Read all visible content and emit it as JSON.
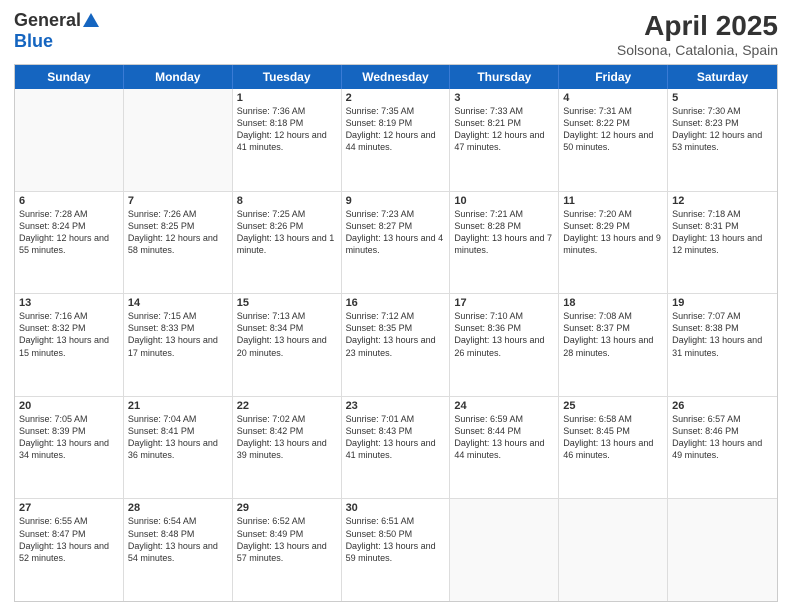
{
  "header": {
    "logo_general": "General",
    "logo_blue": "Blue",
    "title": "April 2025",
    "subtitle": "Solsona, Catalonia, Spain"
  },
  "days": [
    "Sunday",
    "Monday",
    "Tuesday",
    "Wednesday",
    "Thursday",
    "Friday",
    "Saturday"
  ],
  "weeks": [
    [
      {
        "day": "",
        "sunrise": "",
        "sunset": "",
        "daylight": ""
      },
      {
        "day": "",
        "sunrise": "",
        "sunset": "",
        "daylight": ""
      },
      {
        "day": "1",
        "sunrise": "Sunrise: 7:36 AM",
        "sunset": "Sunset: 8:18 PM",
        "daylight": "Daylight: 12 hours and 41 minutes."
      },
      {
        "day": "2",
        "sunrise": "Sunrise: 7:35 AM",
        "sunset": "Sunset: 8:19 PM",
        "daylight": "Daylight: 12 hours and 44 minutes."
      },
      {
        "day": "3",
        "sunrise": "Sunrise: 7:33 AM",
        "sunset": "Sunset: 8:21 PM",
        "daylight": "Daylight: 12 hours and 47 minutes."
      },
      {
        "day": "4",
        "sunrise": "Sunrise: 7:31 AM",
        "sunset": "Sunset: 8:22 PM",
        "daylight": "Daylight: 12 hours and 50 minutes."
      },
      {
        "day": "5",
        "sunrise": "Sunrise: 7:30 AM",
        "sunset": "Sunset: 8:23 PM",
        "daylight": "Daylight: 12 hours and 53 minutes."
      }
    ],
    [
      {
        "day": "6",
        "sunrise": "Sunrise: 7:28 AM",
        "sunset": "Sunset: 8:24 PM",
        "daylight": "Daylight: 12 hours and 55 minutes."
      },
      {
        "day": "7",
        "sunrise": "Sunrise: 7:26 AM",
        "sunset": "Sunset: 8:25 PM",
        "daylight": "Daylight: 12 hours and 58 minutes."
      },
      {
        "day": "8",
        "sunrise": "Sunrise: 7:25 AM",
        "sunset": "Sunset: 8:26 PM",
        "daylight": "Daylight: 13 hours and 1 minute."
      },
      {
        "day": "9",
        "sunrise": "Sunrise: 7:23 AM",
        "sunset": "Sunset: 8:27 PM",
        "daylight": "Daylight: 13 hours and 4 minutes."
      },
      {
        "day": "10",
        "sunrise": "Sunrise: 7:21 AM",
        "sunset": "Sunset: 8:28 PM",
        "daylight": "Daylight: 13 hours and 7 minutes."
      },
      {
        "day": "11",
        "sunrise": "Sunrise: 7:20 AM",
        "sunset": "Sunset: 8:29 PM",
        "daylight": "Daylight: 13 hours and 9 minutes."
      },
      {
        "day": "12",
        "sunrise": "Sunrise: 7:18 AM",
        "sunset": "Sunset: 8:31 PM",
        "daylight": "Daylight: 13 hours and 12 minutes."
      }
    ],
    [
      {
        "day": "13",
        "sunrise": "Sunrise: 7:16 AM",
        "sunset": "Sunset: 8:32 PM",
        "daylight": "Daylight: 13 hours and 15 minutes."
      },
      {
        "day": "14",
        "sunrise": "Sunrise: 7:15 AM",
        "sunset": "Sunset: 8:33 PM",
        "daylight": "Daylight: 13 hours and 17 minutes."
      },
      {
        "day": "15",
        "sunrise": "Sunrise: 7:13 AM",
        "sunset": "Sunset: 8:34 PM",
        "daylight": "Daylight: 13 hours and 20 minutes."
      },
      {
        "day": "16",
        "sunrise": "Sunrise: 7:12 AM",
        "sunset": "Sunset: 8:35 PM",
        "daylight": "Daylight: 13 hours and 23 minutes."
      },
      {
        "day": "17",
        "sunrise": "Sunrise: 7:10 AM",
        "sunset": "Sunset: 8:36 PM",
        "daylight": "Daylight: 13 hours and 26 minutes."
      },
      {
        "day": "18",
        "sunrise": "Sunrise: 7:08 AM",
        "sunset": "Sunset: 8:37 PM",
        "daylight": "Daylight: 13 hours and 28 minutes."
      },
      {
        "day": "19",
        "sunrise": "Sunrise: 7:07 AM",
        "sunset": "Sunset: 8:38 PM",
        "daylight": "Daylight: 13 hours and 31 minutes."
      }
    ],
    [
      {
        "day": "20",
        "sunrise": "Sunrise: 7:05 AM",
        "sunset": "Sunset: 8:39 PM",
        "daylight": "Daylight: 13 hours and 34 minutes."
      },
      {
        "day": "21",
        "sunrise": "Sunrise: 7:04 AM",
        "sunset": "Sunset: 8:41 PM",
        "daylight": "Daylight: 13 hours and 36 minutes."
      },
      {
        "day": "22",
        "sunrise": "Sunrise: 7:02 AM",
        "sunset": "Sunset: 8:42 PM",
        "daylight": "Daylight: 13 hours and 39 minutes."
      },
      {
        "day": "23",
        "sunrise": "Sunrise: 7:01 AM",
        "sunset": "Sunset: 8:43 PM",
        "daylight": "Daylight: 13 hours and 41 minutes."
      },
      {
        "day": "24",
        "sunrise": "Sunrise: 6:59 AM",
        "sunset": "Sunset: 8:44 PM",
        "daylight": "Daylight: 13 hours and 44 minutes."
      },
      {
        "day": "25",
        "sunrise": "Sunrise: 6:58 AM",
        "sunset": "Sunset: 8:45 PM",
        "daylight": "Daylight: 13 hours and 46 minutes."
      },
      {
        "day": "26",
        "sunrise": "Sunrise: 6:57 AM",
        "sunset": "Sunset: 8:46 PM",
        "daylight": "Daylight: 13 hours and 49 minutes."
      }
    ],
    [
      {
        "day": "27",
        "sunrise": "Sunrise: 6:55 AM",
        "sunset": "Sunset: 8:47 PM",
        "daylight": "Daylight: 13 hours and 52 minutes."
      },
      {
        "day": "28",
        "sunrise": "Sunrise: 6:54 AM",
        "sunset": "Sunset: 8:48 PM",
        "daylight": "Daylight: 13 hours and 54 minutes."
      },
      {
        "day": "29",
        "sunrise": "Sunrise: 6:52 AM",
        "sunset": "Sunset: 8:49 PM",
        "daylight": "Daylight: 13 hours and 57 minutes."
      },
      {
        "day": "30",
        "sunrise": "Sunrise: 6:51 AM",
        "sunset": "Sunset: 8:50 PM",
        "daylight": "Daylight: 13 hours and 59 minutes."
      },
      {
        "day": "",
        "sunrise": "",
        "sunset": "",
        "daylight": ""
      },
      {
        "day": "",
        "sunrise": "",
        "sunset": "",
        "daylight": ""
      },
      {
        "day": "",
        "sunrise": "",
        "sunset": "",
        "daylight": ""
      }
    ]
  ]
}
